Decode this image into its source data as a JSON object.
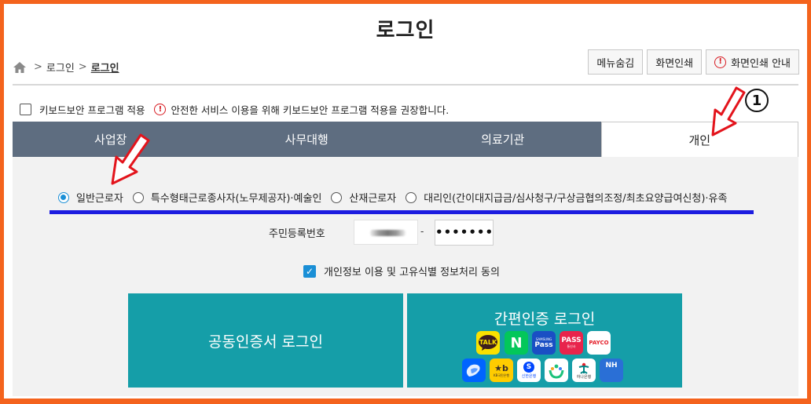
{
  "page": {
    "title": "로그인"
  },
  "breadcrumb": {
    "items": [
      "로그인",
      "로그인"
    ]
  },
  "top_buttons": {
    "hide_menu": "메뉴숨김",
    "print": "화면인쇄",
    "print_guide": "화면인쇄 안내"
  },
  "keyboard": {
    "label": "키보드보안 프로그램 적용",
    "notice": "안전한 서비스 이용을 위해 키보드보안 프로그램 적용을 권장합니다."
  },
  "tabs": [
    {
      "label": "사업장",
      "active": false
    },
    {
      "label": "사무대행",
      "active": false
    },
    {
      "label": "의료기관",
      "active": false
    },
    {
      "label": "개인",
      "active": true
    }
  ],
  "user_types": [
    {
      "label": "일반근로자",
      "selected": true
    },
    {
      "label": "특수형태근로종사자(노무제공자)·예술인",
      "selected": false
    },
    {
      "label": "산재근로자",
      "selected": false
    },
    {
      "label": "대리인(간이대지급금/심사청구/구상금협의조정/최초요양급여신청)·유족",
      "selected": false
    }
  ],
  "rrn": {
    "label": "주민등록번호",
    "separator": "-",
    "back_value": "•••••••"
  },
  "consent": {
    "label": "개인정보 이용 및 고유식별 정보처리 동의",
    "checked": true
  },
  "login": {
    "certificate": "공동인증서 로그인",
    "easy": "간편인증 로그인"
  },
  "easy_auth_providers": [
    {
      "name": "kakao-talk",
      "text": "TALK",
      "bg": "#fae100",
      "fg": "#3c1e1e"
    },
    {
      "name": "naver",
      "text": "N",
      "bg": "#03c75a",
      "fg": "#ffffff"
    },
    {
      "name": "samsung-pass",
      "text": "Pass",
      "sub": "SAMSUNG",
      "bg": "#1a4fc4",
      "fg": "#ffffff"
    },
    {
      "name": "pass",
      "text": "PASS",
      "sub": "통신사",
      "bg": "#e8244c",
      "fg": "#ffffff"
    },
    {
      "name": "payco",
      "text": "PAYCO",
      "bg": "#ffffff",
      "fg": "#e4202b"
    },
    {
      "name": "toss",
      "text": "",
      "bg": "#0064ff",
      "fg": "#ffffff"
    },
    {
      "name": "kb-bank",
      "text": "★b",
      "sub": "KB국민은행",
      "bg": "#ffcc00",
      "fg": "#3a2f2a"
    },
    {
      "name": "shinhan-bank",
      "text": "S",
      "sub": "신한은행",
      "bg": "#ffffff",
      "fg": "#0046ff"
    },
    {
      "name": "banksalad",
      "text": "",
      "bg": "#ffffff",
      "fg": "#1cc27b"
    },
    {
      "name": "hana-bank",
      "text": "",
      "sub": "하나은행",
      "bg": "#ffffff",
      "fg": "#008485"
    },
    {
      "name": "nh-bank",
      "text": "NH",
      "bg": "#2a6fd6",
      "fg": "#ffffff"
    }
  ],
  "annotation": {
    "number": "①"
  },
  "colors": {
    "frame": "#f4631d",
    "tab_bg": "#5e6d80",
    "login_bg": "#159ea8",
    "highlight_line": "#1c1ce0",
    "arrow": "#e3141c",
    "radio_checked": "#1a8fd6"
  }
}
